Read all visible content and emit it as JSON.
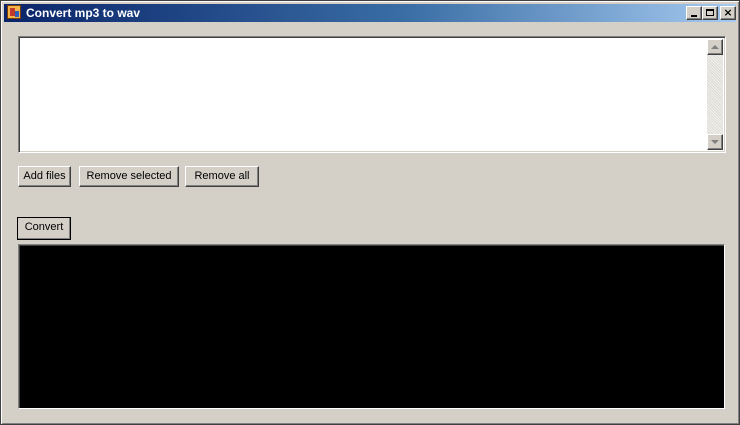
{
  "window": {
    "title": "Convert mp3 to wav",
    "icon": "app-icon",
    "controls": {
      "minimize": "minimize-icon",
      "maximize": "maximize-icon",
      "close": "×"
    }
  },
  "file_list": {
    "items": []
  },
  "buttons": {
    "add_files": "Add files",
    "remove_selected": "Remove selected",
    "remove_all": "Remove all",
    "convert": "Convert"
  },
  "output": {
    "text": "",
    "background": "#000000"
  },
  "colors": {
    "window_face": "#d4d0c8",
    "titlebar_start": "#0a246a",
    "titlebar_end": "#a6caf0"
  }
}
